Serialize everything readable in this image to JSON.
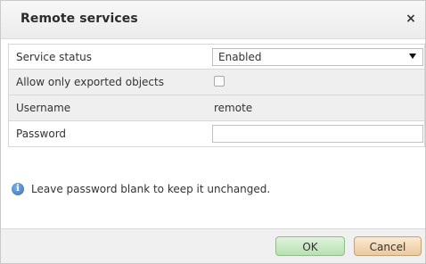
{
  "dialog": {
    "title": "Remote services",
    "close_glyph": "×"
  },
  "form": {
    "service_status": {
      "label": "Service status",
      "value": "Enabled"
    },
    "allow_exported": {
      "label": "Allow only exported objects",
      "checked": false
    },
    "username": {
      "label": "Username",
      "value": "remote"
    },
    "password": {
      "label": "Password",
      "value": ""
    }
  },
  "info": {
    "icon": "info-icon",
    "text": "Leave password blank to keep it unchanged."
  },
  "footer": {
    "ok_label": "OK",
    "cancel_label": "Cancel"
  }
}
